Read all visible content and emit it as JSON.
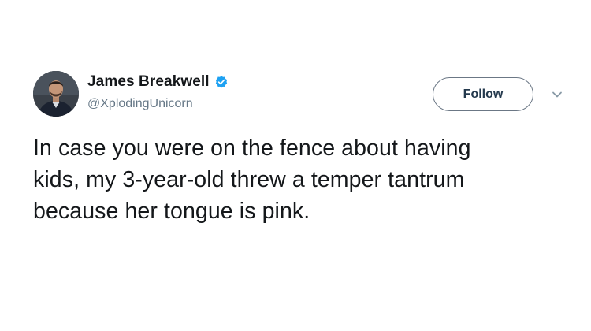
{
  "tweet": {
    "author": {
      "display_name": "James Breakwell",
      "handle": "@XplodingUnicorn",
      "verified": true,
      "avatar_icon": "person-avatar"
    },
    "follow_label": "Follow",
    "menu_icon": "chevron-down-icon",
    "text_lines": [
      "In case you were on the fence about having",
      "kids, my 3-year-old threw a temper tantrum",
      "because her tongue is pink."
    ]
  },
  "colors": {
    "verified_badge": "#1da1f2",
    "name_text": "#14171a",
    "handle_text": "#657786",
    "follow_border": "#6b7785",
    "follow_text": "#24394d"
  }
}
